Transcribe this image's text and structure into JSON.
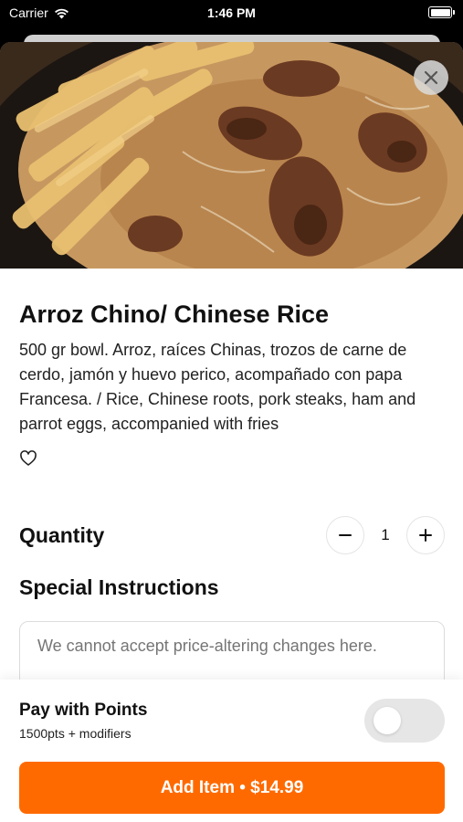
{
  "status_bar": {
    "carrier": "Carrier",
    "time": "1:46 PM",
    "wifi_icon": "wifi-icon",
    "battery_icon": "battery-icon"
  },
  "item": {
    "image_icon": "food-photo",
    "title": "Arroz Chino/ Chinese Rice",
    "description": "500 gr bowl. Arroz, raíces Chinas, trozos de carne de cerdo, jamón y huevo perico, acompañado con papa Francesa. / Rice, Chinese roots, pork steaks, ham and parrot eggs, accompanied with fries",
    "favorite_icon": "heart-icon"
  },
  "quantity": {
    "label": "Quantity",
    "value": "1",
    "decrement_icon": "minus-icon",
    "increment_icon": "plus-icon"
  },
  "special_instructions": {
    "label": "Special Instructions",
    "placeholder": "We cannot accept price-altering changes here.",
    "value": ""
  },
  "points": {
    "title": "Pay with Points",
    "subtitle": "1500pts + modifiers",
    "enabled": false
  },
  "add_button": {
    "label": "Add Item • $14.99"
  },
  "colors": {
    "accent": "#ff6a00",
    "toggle_off": "#e6e6e6"
  }
}
